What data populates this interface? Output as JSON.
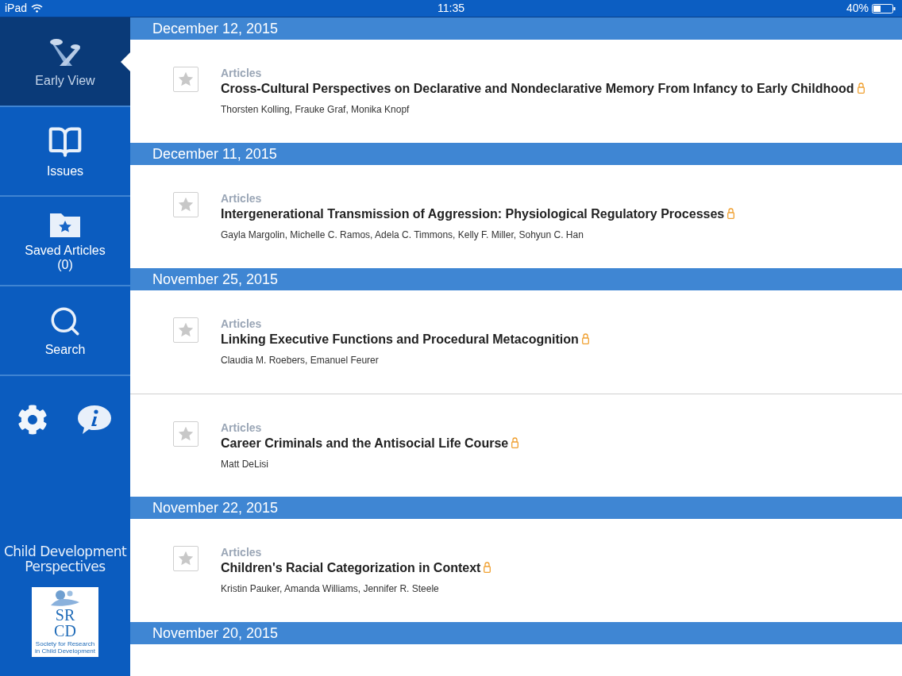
{
  "status_bar": {
    "device": "iPad",
    "time": "11:35",
    "battery": "40%"
  },
  "sidebar": {
    "nav": [
      {
        "kind": "early",
        "label": "Early View",
        "selected": true
      },
      {
        "kind": "issues",
        "label": "Issues",
        "selected": false
      },
      {
        "kind": "saved",
        "label": "Saved Articles",
        "count": "(0)",
        "selected": false
      },
      {
        "kind": "search",
        "label": "Search",
        "selected": false
      }
    ],
    "journal_title": "Child Development Perspectives",
    "logo": {
      "top": "SR",
      "bottom": "CD",
      "caption": "Society for Research in Child Development"
    }
  },
  "sections": [
    {
      "date": "December 12, 2015",
      "articles": [
        {
          "category": "Articles",
          "title": "Cross-Cultural Perspectives on Declarative and Nondeclarative Memory From Infancy to Early Childhood",
          "authors": "Thorsten Kolling, Frauke Graf, Monika Knopf",
          "starred": false,
          "locked": true
        }
      ]
    },
    {
      "date": "December 11, 2015",
      "articles": [
        {
          "category": "Articles",
          "title": "Intergenerational Transmission of Aggression: Physiological Regulatory Processes",
          "authors": "Gayla Margolin, Michelle C. Ramos, Adela C. Timmons, Kelly F. Miller, Sohyun C. Han",
          "starred": false,
          "locked": true
        }
      ]
    },
    {
      "date": "November 25, 2015",
      "articles": [
        {
          "category": "Articles",
          "title": "Linking Executive Functions and Procedural Metacognition",
          "authors": "Claudia M. Roebers, Emanuel Feurer",
          "starred": false,
          "locked": true
        },
        {
          "category": "Articles",
          "title": "Career Criminals and the Antisocial Life Course",
          "authors": "Matt DeLisi",
          "starred": false,
          "locked": true
        }
      ]
    },
    {
      "date": "November 22, 2015",
      "articles": [
        {
          "category": "Articles",
          "title": "Children's Racial Categorization in Context",
          "authors": "Kristin Pauker, Amanda Williams, Jennifer R. Steele",
          "starred": false,
          "locked": true
        }
      ]
    },
    {
      "date": "November 20, 2015"
    }
  ]
}
